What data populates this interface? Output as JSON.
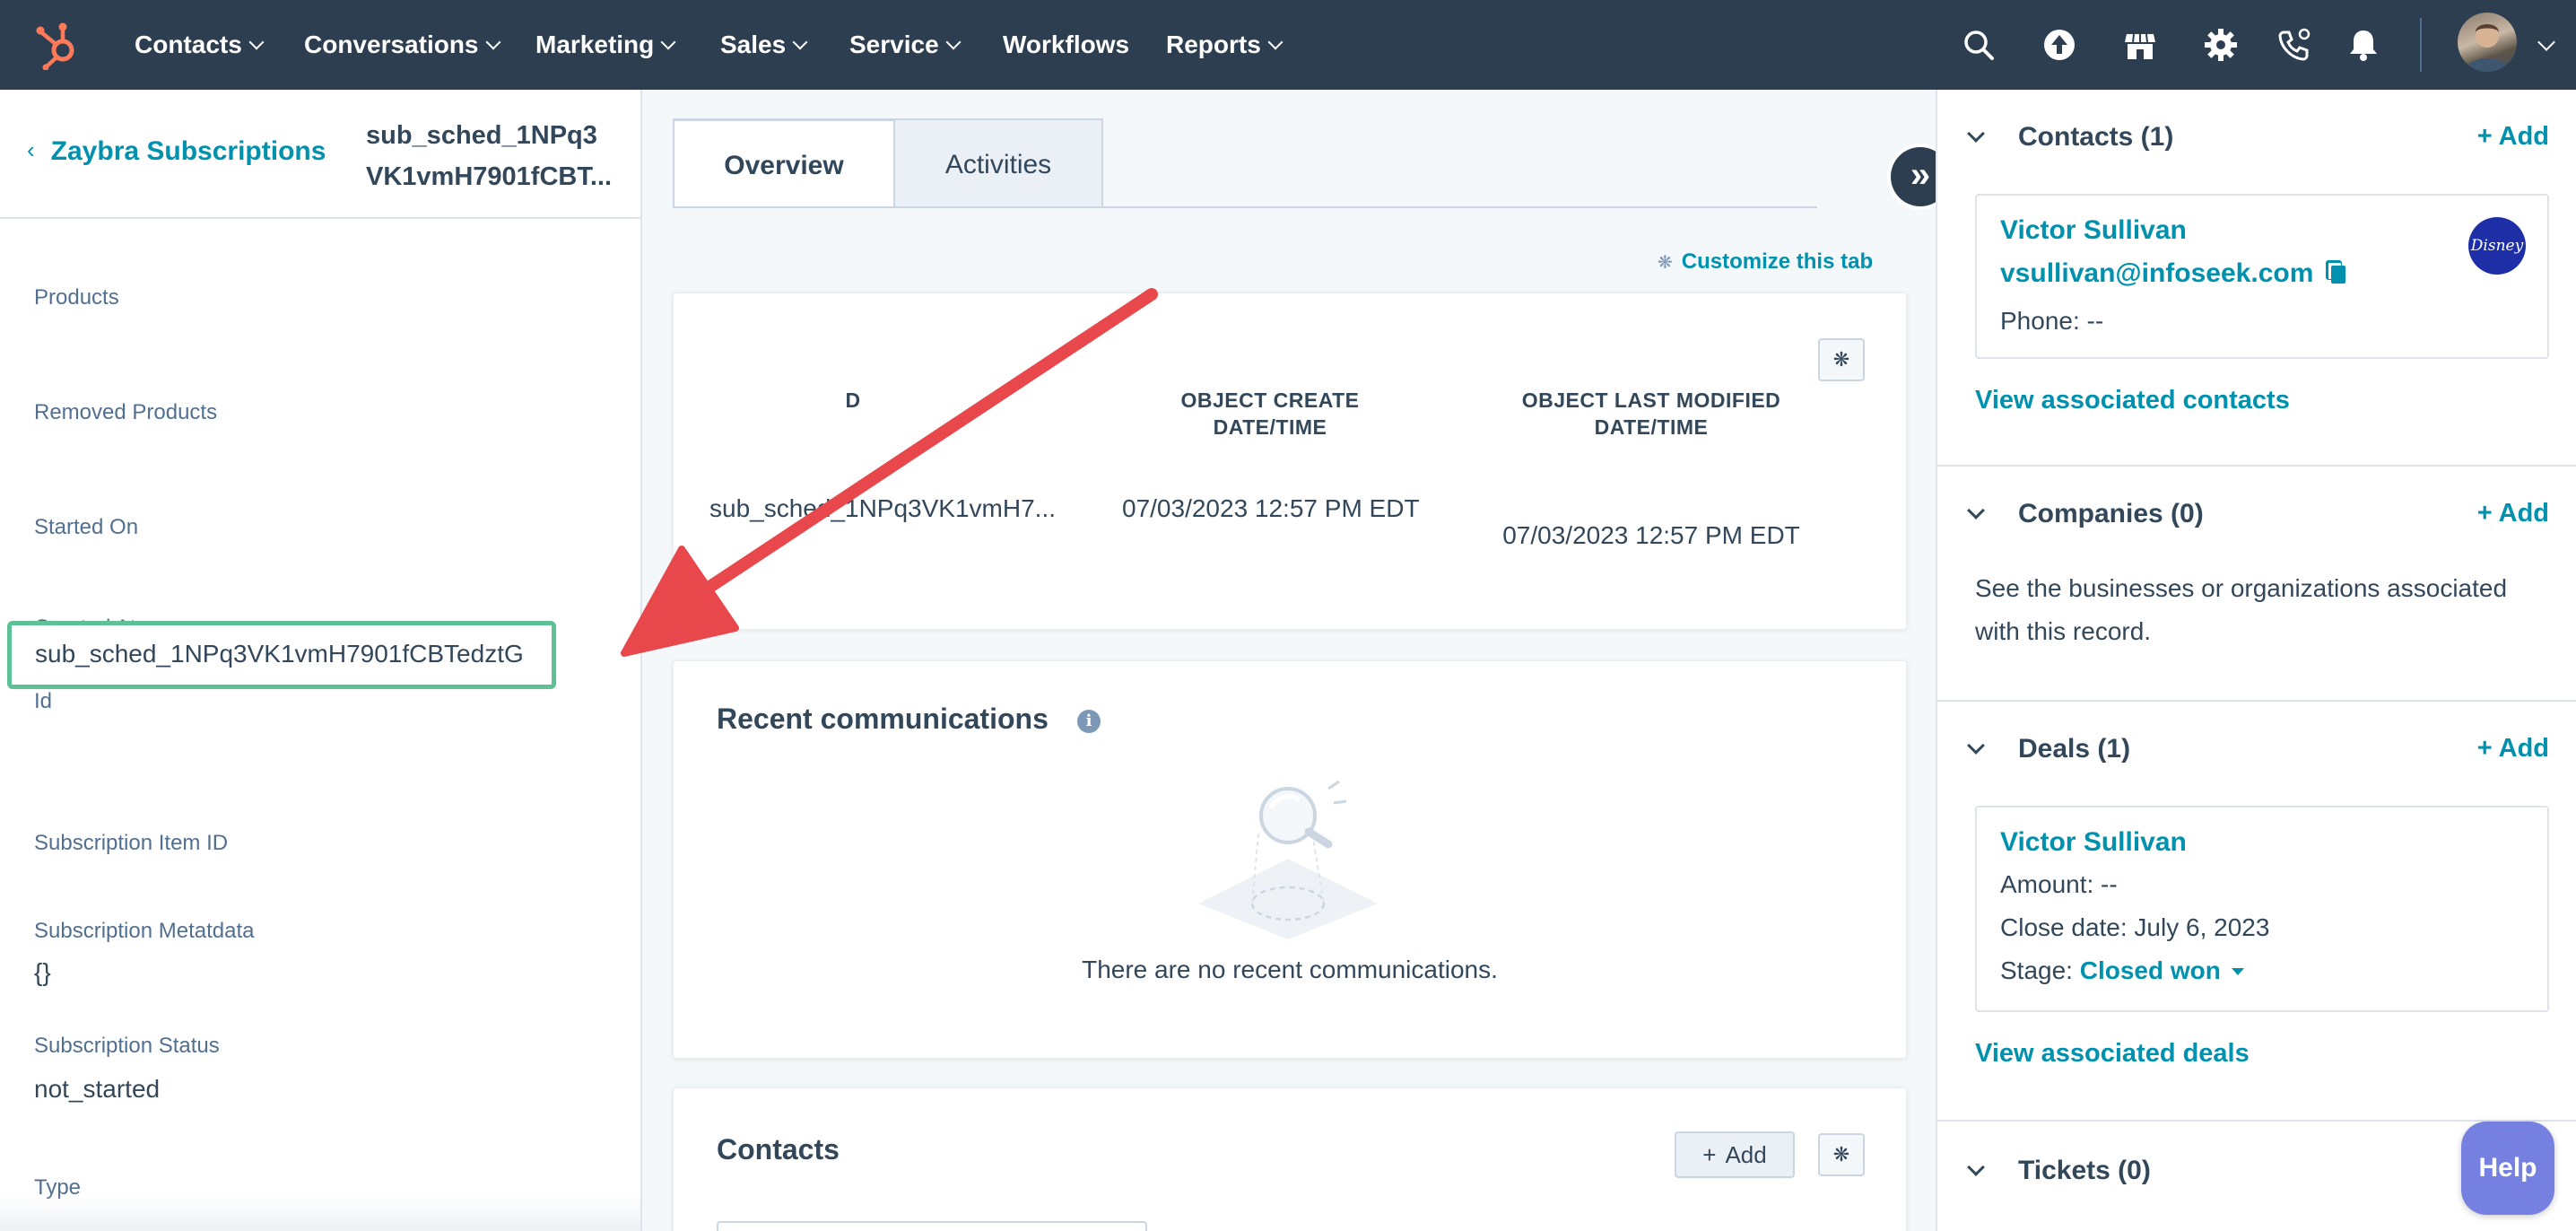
{
  "nav": {
    "items": [
      {
        "label": "Contacts",
        "has_menu": true
      },
      {
        "label": "Conversations",
        "has_menu": true
      },
      {
        "label": "Marketing",
        "has_menu": true
      },
      {
        "label": "Sales",
        "has_menu": true
      },
      {
        "label": "Service",
        "has_menu": true
      },
      {
        "label": "Workflows",
        "has_menu": false
      },
      {
        "label": "Reports",
        "has_menu": true
      }
    ],
    "icons": [
      "search-icon",
      "upgrade-icon",
      "marketplace-icon",
      "settings-icon",
      "calling-icon",
      "notifications-icon"
    ]
  },
  "left": {
    "back_label": "Zaybra Subscriptions",
    "record_title_line1": "sub_sched_1NPq3",
    "record_title_line2": "VK1vmH7901fCBT...",
    "properties": {
      "products_label": "Products",
      "removed_products_label": "Removed Products",
      "started_on_label": "Started On",
      "created_at_label": "Created At",
      "id_label": "Id",
      "id_value": "sub_sched_1NPq3VK1vmH7901fCBTedztG",
      "subscription_item_id_label": "Subscription Item ID",
      "subscription_metadata_label": "Subscription Metatdata",
      "subscription_metadata_value": "{}",
      "subscription_status_label": "Subscription Status",
      "subscription_status_value": "not_started",
      "type_label": "Type"
    }
  },
  "middle": {
    "tabs": [
      {
        "label": "Overview",
        "active": true
      },
      {
        "label": "Activities",
        "active": false
      }
    ],
    "customize_label": "Customize this tab",
    "highlights": {
      "col1_head": "D",
      "col1_value": "sub_sched_1NPq3VK1vmH7...",
      "col2_head": "OBJECT CREATE DATE/TIME",
      "col2_value": "07/03/2023 12:57 PM EDT",
      "col3_head_line1": "OBJECT LAST MODIFIED",
      "col3_head_line2": "DATE/TIME",
      "col3_value": "07/03/2023 12:57 PM EDT"
    },
    "recent_comms": {
      "title": "Recent communications",
      "empty_text": "There are no recent communications."
    },
    "contacts_card": {
      "title": "Contacts",
      "add_label": "Add"
    }
  },
  "right": {
    "contacts": {
      "title": "Contacts (1)",
      "add_label": "+ Add",
      "name": "Victor Sullivan",
      "email": "vsullivan@infoseek.com",
      "phone": "Phone: --",
      "logo_text": "Disney",
      "view_all": "View associated contacts"
    },
    "companies": {
      "title": "Companies (0)",
      "add_label": "+ Add",
      "description_line1": "See the businesses or organizations associated",
      "description_line2": "with this record."
    },
    "deals": {
      "title": "Deals (1)",
      "add_label": "+ Add",
      "name": "Victor Sullivan",
      "amount": "Amount: --",
      "close_date": "Close date: July 6, 2023",
      "stage_label": "Stage:",
      "stage_value": "Closed won",
      "view_all": "View associated deals"
    },
    "tickets": {
      "title": "Tickets (0)"
    }
  },
  "help_label": "Help",
  "colors": {
    "nav_bg": "#2d3e50",
    "link": "#0091ae",
    "highlight_box": "#5ec196",
    "annotation_arrow": "#e8484c",
    "help_button": "#7580e0"
  }
}
